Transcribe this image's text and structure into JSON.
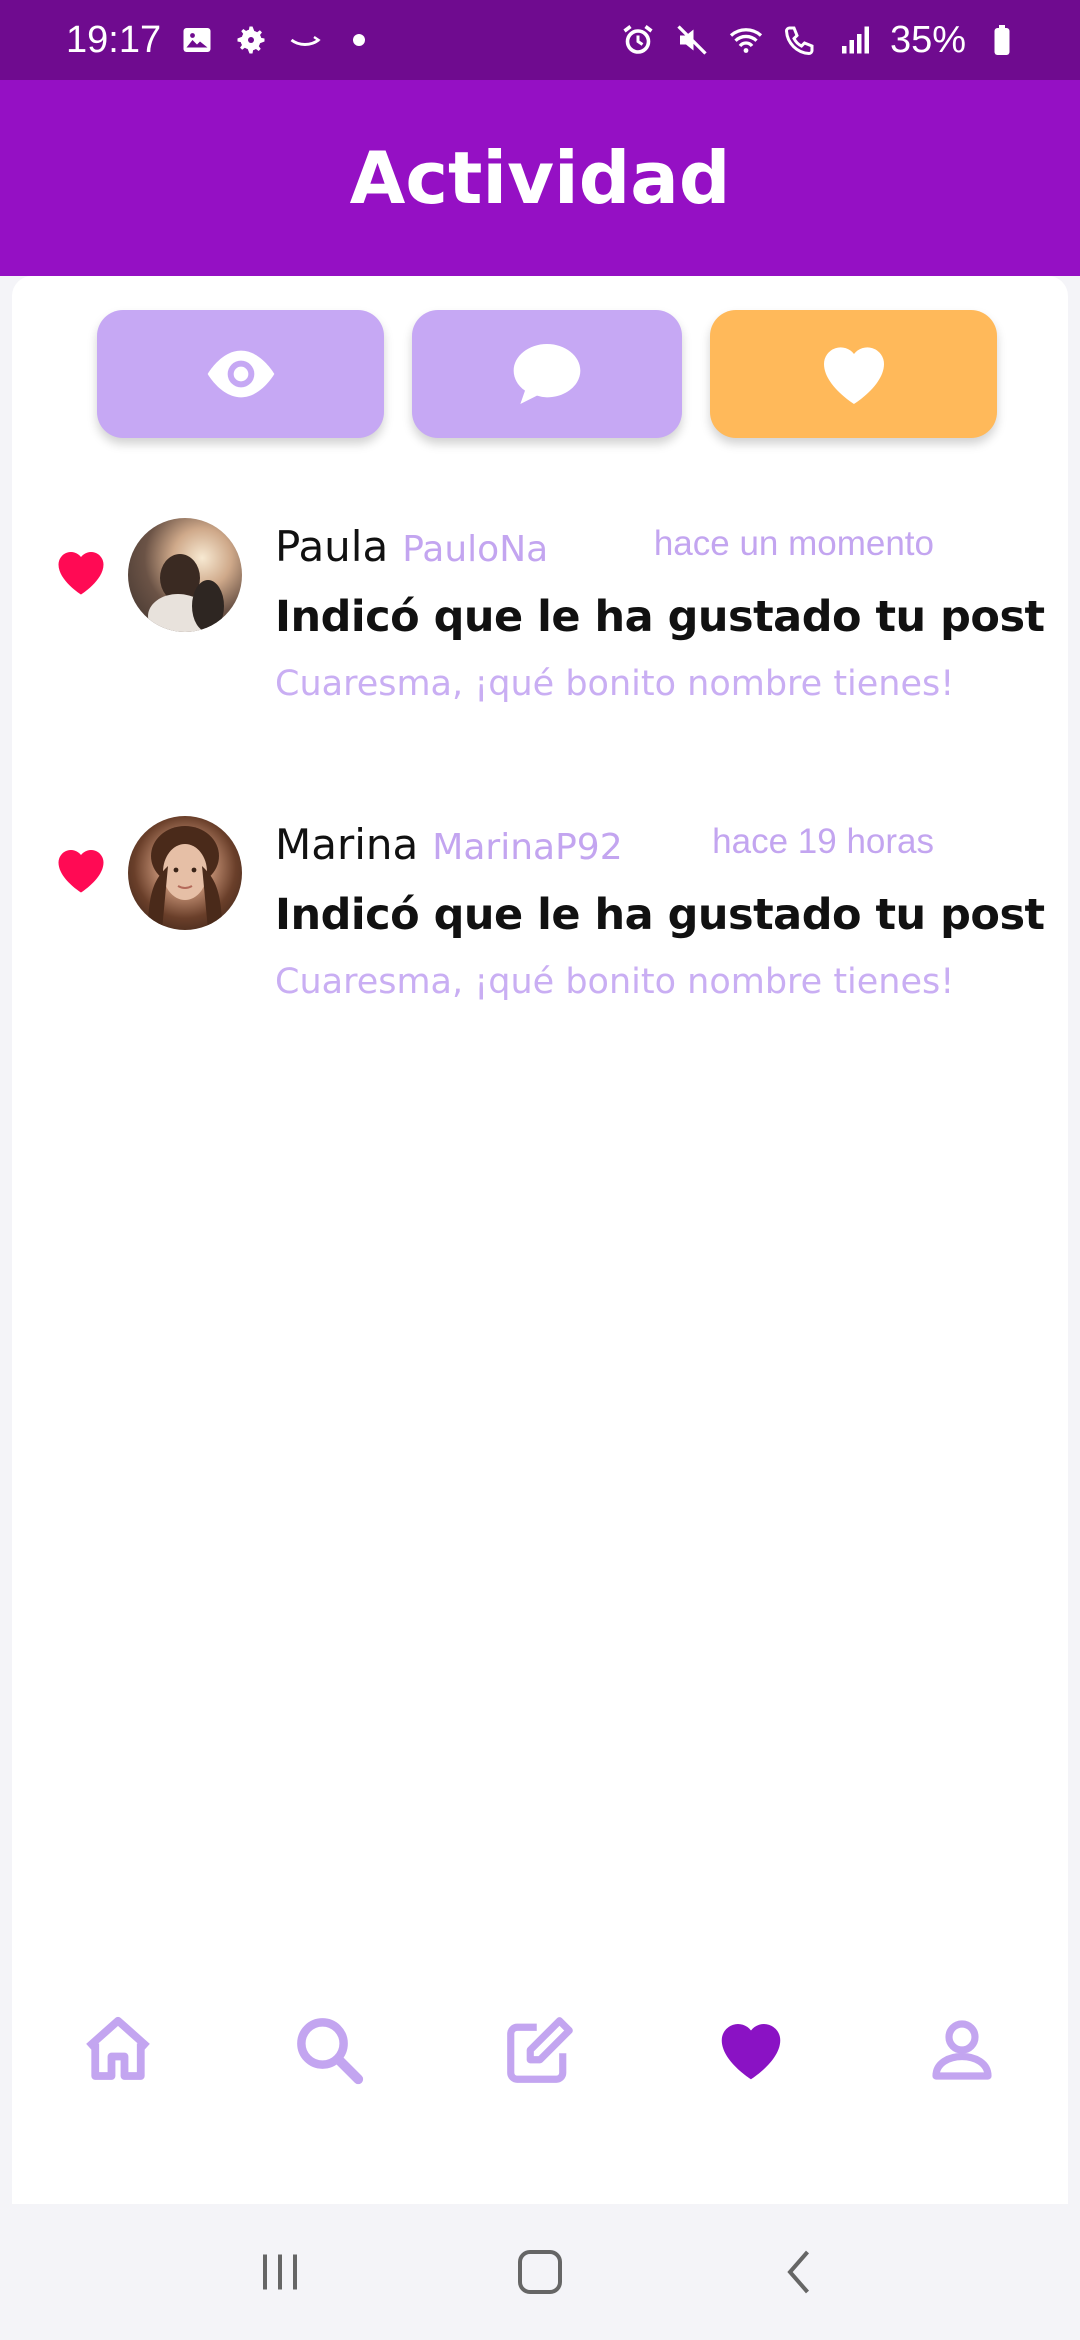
{
  "status_bar": {
    "time": "19:17",
    "battery": "35%",
    "left_icons": [
      "image-icon",
      "gear-icon",
      "amazon-icon",
      "dot-icon"
    ],
    "right_icons": [
      "alarm-icon",
      "mute-icon",
      "wifi-icon",
      "wifi-call-icon",
      "signal-icon",
      "battery-icon"
    ]
  },
  "app_bar": {
    "title": "Actividad"
  },
  "filters": [
    {
      "name": "views",
      "icon": "eye-icon",
      "color": "#c6a8f4",
      "active": false
    },
    {
      "name": "comments",
      "icon": "comment-icon",
      "color": "#c6a8f4",
      "active": false
    },
    {
      "name": "likes",
      "icon": "heart-icon",
      "color": "#ffb95a",
      "active": true
    }
  ],
  "activities": [
    {
      "name": "Paula",
      "username": "PauloNa",
      "time": "hace un momento",
      "title": "Indicó que le ha gustado tu post",
      "text": "Cuaresma, ¡qué bonito nombre tienes!",
      "icon": "heart-icon"
    },
    {
      "name": "Marina",
      "username": "MarinaP92",
      "time": "hace 19 horas",
      "title": "Indicó que le ha gustado tu post",
      "text": "Cuaresma, ¡qué bonito nombre tienes!",
      "icon": "heart-icon"
    }
  ],
  "bottom_nav": [
    {
      "icon": "home-icon",
      "active": false
    },
    {
      "icon": "search-icon",
      "active": false
    },
    {
      "icon": "edit-icon",
      "active": false
    },
    {
      "icon": "heart-icon",
      "active": true
    },
    {
      "icon": "profile-icon",
      "active": false
    }
  ],
  "colors": {
    "status_bar": "#6f0b8f",
    "app_bar": "#9510c4",
    "accent_light": "#c3a5f0",
    "heart_red": "#ff0a54",
    "nav_active": "#8a12c4"
  }
}
